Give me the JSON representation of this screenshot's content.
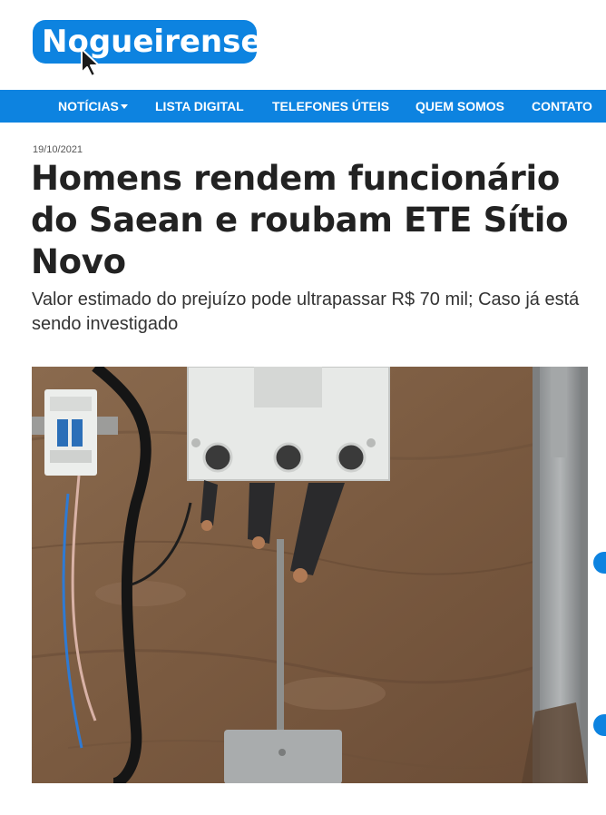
{
  "site": {
    "logo_text": "Nogueirense",
    "brand_color": "#0d83e0"
  },
  "nav": {
    "items": [
      {
        "label": "NOTÍCIAS",
        "has_dropdown": true
      },
      {
        "label": "LISTA DIGITAL",
        "has_dropdown": false
      },
      {
        "label": "TELEFONES ÚTEIS",
        "has_dropdown": false
      },
      {
        "label": "QUEM SOMOS",
        "has_dropdown": false
      },
      {
        "label": "CONTATO",
        "has_dropdown": false
      }
    ]
  },
  "article": {
    "date": "19/10/2021",
    "title": "Homens rendem funcionário do Saean e roubam ETE Sítio Novo",
    "subtitle": "Valor estimado do prejuízo pode ultrapassar R$ 70 mil; Caso já está sendo investigado"
  },
  "icons": [
    "cursor-arrow-icon",
    "chevron-down-icon"
  ]
}
